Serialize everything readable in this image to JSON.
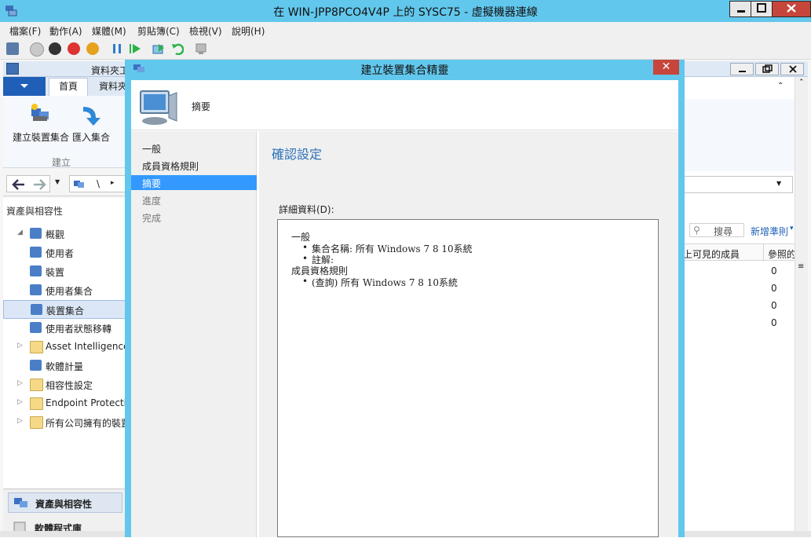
{
  "vm": {
    "title": "在 WIN-JPP8PCO4V4P 上的 SYSC75 - 虛擬機器連線",
    "menu": [
      "檔案(F)",
      "動作(A)",
      "媒體(M)",
      "剪貼簿(C)",
      "檢視(V)",
      "說明(H)"
    ],
    "toolbar_icons": [
      "ctrl-alt-del-icon",
      "start-icon",
      "turn-off-icon",
      "shutdown-icon",
      "power-icon",
      "pause-icon",
      "resume-icon",
      "checkpoint-icon",
      "revert-icon",
      "enhanced-session-icon"
    ]
  },
  "console": {
    "title_fragment": "資料夾工",
    "ribbon_tabs": [
      "首頁",
      "資料夾"
    ],
    "ribbon_buttons": [
      "建立裝置集合",
      "匯入集合"
    ],
    "ribbon_group": "建立",
    "breadcrumb_sep": "\\",
    "workspace_title": "資產與相容性",
    "tree": [
      {
        "label": "概觀",
        "icon": "overview-icon",
        "expander": "◢"
      },
      {
        "label": "使用者",
        "icon": "user-icon",
        "expander": ""
      },
      {
        "label": "裝置",
        "icon": "device-icon",
        "expander": ""
      },
      {
        "label": "使用者集合",
        "icon": "user-collection-icon",
        "expander": ""
      },
      {
        "label": "裝置集合",
        "icon": "device-collection-icon",
        "expander": "",
        "selected": true
      },
      {
        "label": "使用者狀態移轉",
        "icon": "user-state-migration-icon",
        "expander": ""
      },
      {
        "label": "Asset Intelligence",
        "icon": "folder-icon",
        "expander": "▷"
      },
      {
        "label": "軟體計量",
        "icon": "software-metering-icon",
        "expander": ""
      },
      {
        "label": "相容性設定",
        "icon": "folder-icon",
        "expander": "▷"
      },
      {
        "label": "Endpoint Protection",
        "icon": "folder-icon",
        "expander": "▷"
      },
      {
        "label": "所有公司擁有的裝置",
        "icon": "folder-icon",
        "expander": "▷"
      }
    ],
    "wunderbar": [
      "資產與相容性",
      "軟體程式庫"
    ],
    "search_label": "搜尋",
    "add_criteria": "新增準則",
    "columns": [
      "上可見的成員",
      "參照的"
    ],
    "rows": [
      "0",
      "0",
      "0",
      "0"
    ]
  },
  "wizard": {
    "title": "建立裝置集合精靈",
    "header": "摘要",
    "steps": [
      {
        "label": "一般",
        "state": "normal"
      },
      {
        "label": "成員資格規則",
        "state": "normal"
      },
      {
        "label": "摘要",
        "state": "selected"
      },
      {
        "label": "進度",
        "state": "dim"
      },
      {
        "label": "完成",
        "state": "dim"
      }
    ],
    "content_title": "確認設定",
    "details_label": "詳細資料(D):",
    "details": {
      "general_heading": "一般",
      "collection_name": "集合名稱: 所有 Windows 7 8 10系統",
      "comment": "註解:",
      "membership_heading": "成員資格規則",
      "query_rule": "(查詢) 所有 Windows 7 8 10系統"
    }
  }
}
